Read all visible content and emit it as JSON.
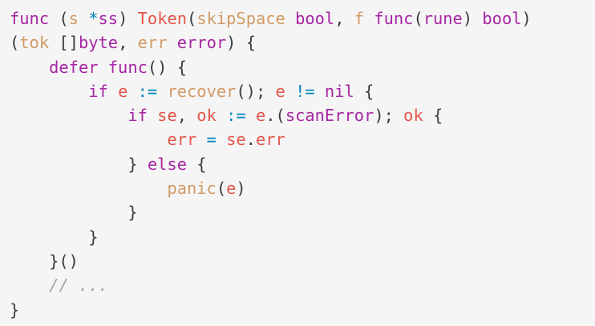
{
  "colors": {
    "background": "#f5f5f5",
    "keyword": "#a626a4",
    "identifier": "#e45649",
    "plain": "#383a42",
    "operator": "#0184bc",
    "orange": "#d19a66",
    "comment": "#a0a1a7"
  },
  "lines": [
    [
      {
        "t": "func",
        "c": "kw"
      },
      {
        "t": " (",
        "c": "plain"
      },
      {
        "t": "s",
        "c": "orange"
      },
      {
        "t": " ",
        "c": "plain"
      },
      {
        "t": "*",
        "c": "op"
      },
      {
        "t": "ss",
        "c": "kw"
      },
      {
        "t": ") ",
        "c": "plain"
      },
      {
        "t": "Token",
        "c": "id"
      },
      {
        "t": "(",
        "c": "plain"
      },
      {
        "t": "skipSpace",
        "c": "orange"
      },
      {
        "t": " ",
        "c": "plain"
      },
      {
        "t": "bool",
        "c": "kw"
      },
      {
        "t": ", ",
        "c": "plain"
      },
      {
        "t": "f",
        "c": "orange"
      },
      {
        "t": " ",
        "c": "plain"
      },
      {
        "t": "func",
        "c": "kw"
      },
      {
        "t": "(",
        "c": "plain"
      },
      {
        "t": "rune",
        "c": "kw"
      },
      {
        "t": ") ",
        "c": "plain"
      },
      {
        "t": "bool",
        "c": "kw"
      },
      {
        "t": ")",
        "c": "plain"
      }
    ],
    [
      {
        "t": "(",
        "c": "plain"
      },
      {
        "t": "tok",
        "c": "orange"
      },
      {
        "t": " []",
        "c": "plain"
      },
      {
        "t": "byte",
        "c": "kw"
      },
      {
        "t": ", ",
        "c": "plain"
      },
      {
        "t": "err",
        "c": "orange"
      },
      {
        "t": " ",
        "c": "plain"
      },
      {
        "t": "error",
        "c": "kw"
      },
      {
        "t": ") {",
        "c": "plain"
      }
    ],
    [
      {
        "t": "    ",
        "c": "plain"
      },
      {
        "t": "defer",
        "c": "kw"
      },
      {
        "t": " ",
        "c": "plain"
      },
      {
        "t": "func",
        "c": "kw"
      },
      {
        "t": "() {",
        "c": "plain"
      }
    ],
    [
      {
        "t": "        ",
        "c": "plain"
      },
      {
        "t": "if",
        "c": "kw"
      },
      {
        "t": " ",
        "c": "plain"
      },
      {
        "t": "e",
        "c": "id"
      },
      {
        "t": " ",
        "c": "plain"
      },
      {
        "t": ":=",
        "c": "op"
      },
      {
        "t": " ",
        "c": "plain"
      },
      {
        "t": "recover",
        "c": "orange"
      },
      {
        "t": "(); ",
        "c": "plain"
      },
      {
        "t": "e",
        "c": "id"
      },
      {
        "t": " ",
        "c": "plain"
      },
      {
        "t": "!=",
        "c": "op"
      },
      {
        "t": " ",
        "c": "plain"
      },
      {
        "t": "nil",
        "c": "kw"
      },
      {
        "t": " {",
        "c": "plain"
      }
    ],
    [
      {
        "t": "            ",
        "c": "plain"
      },
      {
        "t": "if",
        "c": "kw"
      },
      {
        "t": " ",
        "c": "plain"
      },
      {
        "t": "se",
        "c": "id"
      },
      {
        "t": ", ",
        "c": "plain"
      },
      {
        "t": "ok",
        "c": "id"
      },
      {
        "t": " ",
        "c": "plain"
      },
      {
        "t": ":=",
        "c": "op"
      },
      {
        "t": " ",
        "c": "plain"
      },
      {
        "t": "e",
        "c": "id"
      },
      {
        "t": ".(",
        "c": "plain"
      },
      {
        "t": "scanError",
        "c": "kw"
      },
      {
        "t": "); ",
        "c": "plain"
      },
      {
        "t": "ok",
        "c": "id"
      },
      {
        "t": " {",
        "c": "plain"
      }
    ],
    [
      {
        "t": "                ",
        "c": "plain"
      },
      {
        "t": "err",
        "c": "id"
      },
      {
        "t": " ",
        "c": "plain"
      },
      {
        "t": "=",
        "c": "op"
      },
      {
        "t": " ",
        "c": "plain"
      },
      {
        "t": "se",
        "c": "id"
      },
      {
        "t": ".",
        "c": "plain"
      },
      {
        "t": "err",
        "c": "id"
      }
    ],
    [
      {
        "t": "            } ",
        "c": "plain"
      },
      {
        "t": "else",
        "c": "kw"
      },
      {
        "t": " {",
        "c": "plain"
      }
    ],
    [
      {
        "t": "                ",
        "c": "plain"
      },
      {
        "t": "panic",
        "c": "orange"
      },
      {
        "t": "(",
        "c": "plain"
      },
      {
        "t": "e",
        "c": "id"
      },
      {
        "t": ")",
        "c": "plain"
      }
    ],
    [
      {
        "t": "            }",
        "c": "plain"
      }
    ],
    [
      {
        "t": "        }",
        "c": "plain"
      }
    ],
    [
      {
        "t": "    }()",
        "c": "plain"
      }
    ],
    [
      {
        "t": "    ",
        "c": "plain"
      },
      {
        "t": "// ...",
        "c": "comment"
      }
    ],
    [
      {
        "t": "}",
        "c": "plain"
      }
    ]
  ]
}
